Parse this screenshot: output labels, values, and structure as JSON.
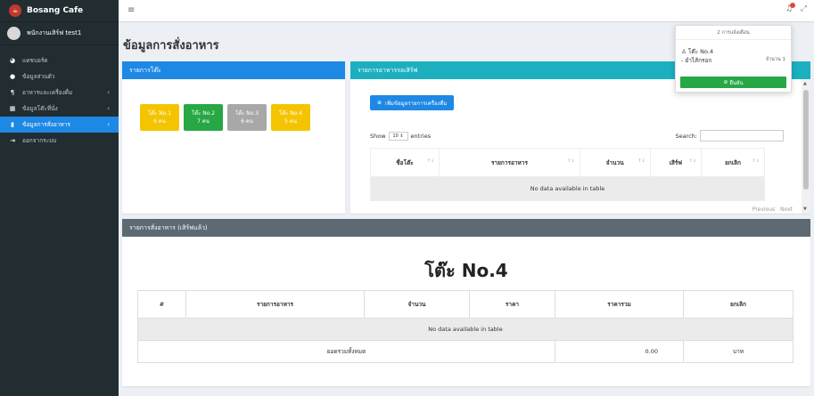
{
  "app": {
    "brand": "Bosang Cafe",
    "user_name": "พนักงานเสิร์ฟ test1"
  },
  "sidebar": {
    "items": [
      {
        "icon": "dashboard-icon",
        "label": "แดชบอร์ด",
        "active": false,
        "has_chevron": false
      },
      {
        "icon": "user-circle-icon",
        "label": "ข้อมูลส่วนตัว",
        "active": false,
        "has_chevron": false
      },
      {
        "icon": "cutlery-icon",
        "label": "อาหารและเครื่องดื่ม",
        "active": false,
        "has_chevron": true
      },
      {
        "icon": "table-icon",
        "label": "ข้อมูลโต๊ะที่นั่ง",
        "active": false,
        "has_chevron": true
      },
      {
        "icon": "clipboard-icon",
        "label": "ข้อมูลการสั่งอาหาร",
        "active": true,
        "has_chevron": true
      },
      {
        "icon": "logout-icon",
        "label": "ออกจากระบบ",
        "active": false,
        "has_chevron": false
      }
    ]
  },
  "page": {
    "title": "ข้อมูลการสั่งอาหาร"
  },
  "tables_panel": {
    "title": "รายการโต๊ะ",
    "tables": [
      {
        "name": "โต๊ะ No.1",
        "seats": "6 คน",
        "color": "#f5c400"
      },
      {
        "name": "โต๊ะ No.2",
        "seats": "7 คน",
        "color": "#28a745"
      },
      {
        "name": "โต๊ะ No.3",
        "seats": "6 คน",
        "color": "#a8a8a8"
      },
      {
        "name": "โต๊ะ No.4",
        "seats": "5 คน",
        "color": "#f5c400"
      }
    ]
  },
  "pending_panel": {
    "title": "รายการอาหารรอเสิร์ฟ",
    "add_button": "เพิ่มข้อมูลรายการเครื่องดื่ม",
    "show_label": "Show",
    "show_value": "10",
    "entries_label": "entries",
    "search_label": "Search:",
    "columns": [
      "ชื่อโต๊ะ",
      "รายการอาหาร",
      "จำนวน",
      "เสิร์ฟ",
      "ยกเลิก"
    ],
    "empty_text": "No data available in table",
    "pager_prev": "Previous",
    "pager_next": "Next"
  },
  "served_panel": {
    "title": "รายการสั่งอาหาร (เสิร์ฟแล้ว)",
    "table_name": "โต๊ะ No.4",
    "columns": [
      "#",
      "รายการอาหาร",
      "จำนวน",
      "ราคา",
      "ราคารวม",
      "ยกเลิก"
    ],
    "empty_text": "No data available in table",
    "total_label": "ยอดรวมทั้งหมด",
    "total_value": "0.00",
    "currency": "บาท"
  },
  "notification": {
    "count_text": "2 การแจ้งเตือน",
    "item_table": "โต๊ะ No.4",
    "item_food": "- ยำไส้กรอก",
    "item_qty": "จำนวน 1",
    "confirm": "ยืนยัน"
  }
}
